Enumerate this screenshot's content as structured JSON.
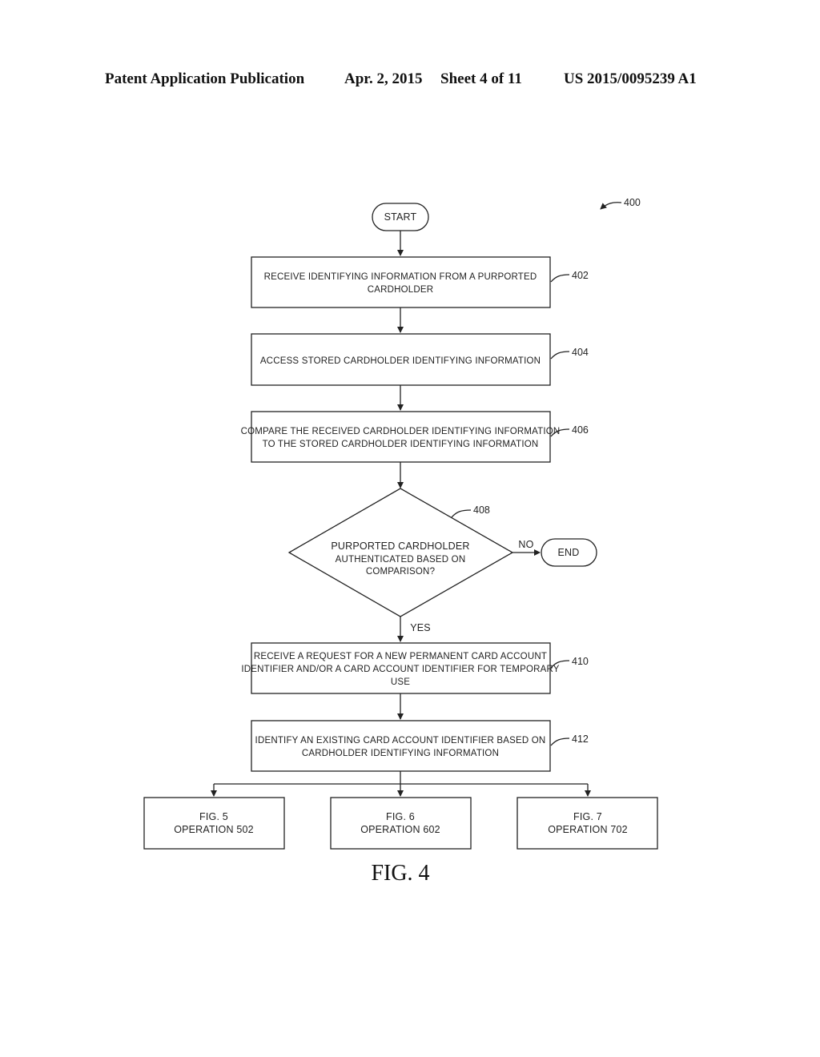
{
  "header": {
    "publication": "Patent Application Publication",
    "date": "Apr. 2, 2015",
    "sheet": "Sheet 4 of 11",
    "number": "US 2015/0095239 A1"
  },
  "figure": {
    "reference": "400",
    "caption": "FIG. 4",
    "start": "START",
    "end": "END",
    "steps": [
      {
        "ref": "402",
        "lines": [
          "RECEIVE IDENTIFYING INFORMATION FROM A PURPORTED",
          "CARDHOLDER"
        ]
      },
      {
        "ref": "404",
        "lines": [
          "ACCESS STORED CARDHOLDER IDENTIFYING INFORMATION"
        ]
      },
      {
        "ref": "406",
        "lines": [
          "COMPARE THE RECEIVED CARDHOLDER IDENTIFYING INFORMATION",
          "TO THE STORED CARDHOLDER IDENTIFYING INFORMATION"
        ]
      },
      {
        "ref": "410",
        "lines": [
          "RECEIVE A REQUEST FOR A NEW PERMANENT CARD ACCOUNT",
          "IDENTIFIER AND/OR A CARD ACCOUNT IDENTIFIER FOR TEMPORARY",
          "USE"
        ]
      },
      {
        "ref": "412",
        "lines": [
          "IDENTIFY AN EXISTING CARD ACCOUNT IDENTIFIER BASED ON",
          "CARDHOLDER IDENTIFYING INFORMATION"
        ]
      }
    ],
    "decision": {
      "ref": "408",
      "lines": [
        "PURPORTED CARDHOLDER",
        "AUTHENTICATED BASED ON",
        "COMPARISON?"
      ],
      "yes": "YES",
      "no": "NO"
    },
    "outputs": [
      {
        "fig": "FIG. 5",
        "operation": "OPERATION 502"
      },
      {
        "fig": "FIG. 6",
        "operation": "OPERATION 602"
      },
      {
        "fig": "FIG. 7",
        "operation": "OPERATION 702"
      }
    ]
  }
}
